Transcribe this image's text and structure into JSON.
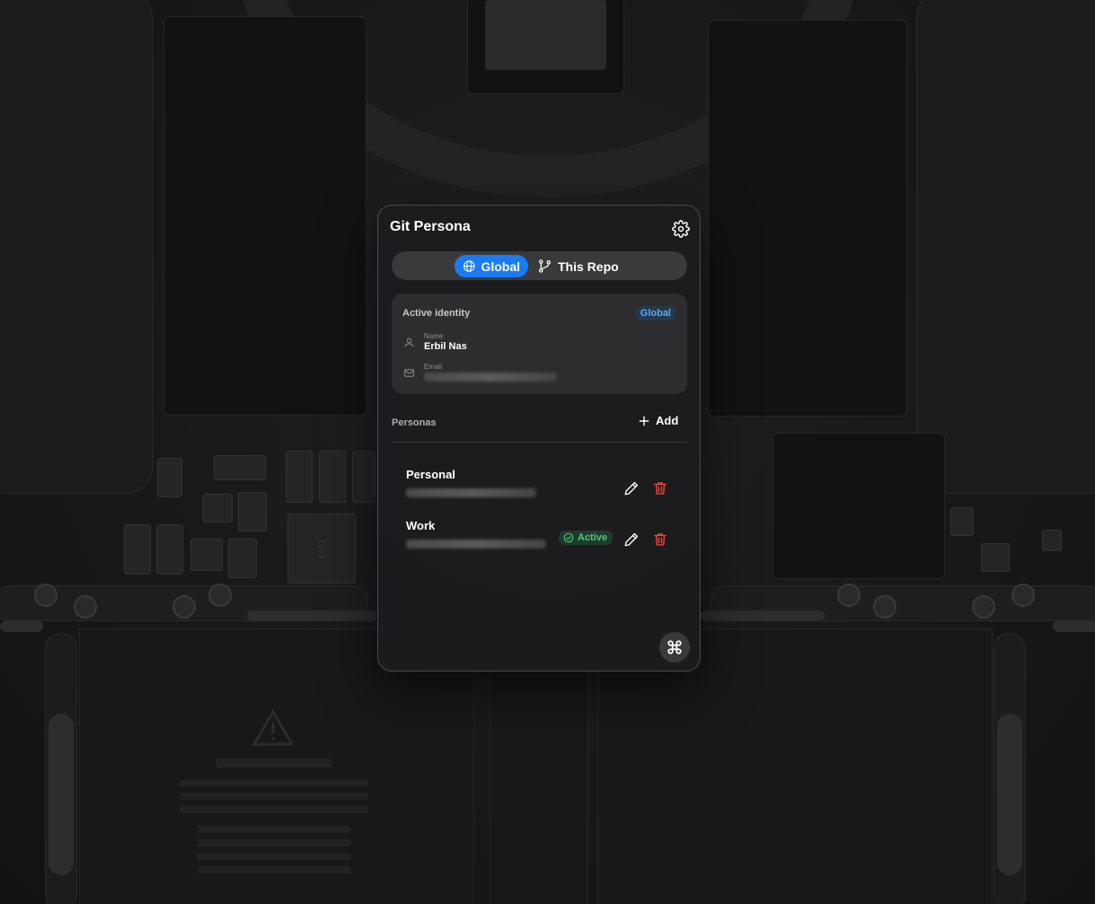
{
  "app": {
    "title": "Git Persona"
  },
  "scope_tabs": [
    {
      "label": "Global",
      "icon": "globe-icon",
      "selected": true
    },
    {
      "label": "This Repo",
      "icon": "git-branch-icon",
      "selected": false
    }
  ],
  "identity": {
    "heading": "Active identity",
    "badge": "Global",
    "name_label": "Name",
    "name_value": "Erbil Nas",
    "email_label": "Email"
  },
  "personas": {
    "label": "Personas",
    "add_label": "Add",
    "items": [
      {
        "name": "Personal",
        "active": false
      },
      {
        "name": "Work",
        "active": true,
        "active_label": "Active"
      }
    ]
  },
  "colors": {
    "accent": "#1a7cf5",
    "active_green": "#4cc97a",
    "delete_red": "#ff453a",
    "badge_blue": "#5aa9f5"
  },
  "wallpaper": {
    "label_text": "1R0"
  }
}
